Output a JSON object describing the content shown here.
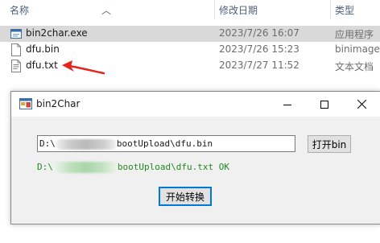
{
  "explorer": {
    "columns": {
      "name": "名称",
      "modified": "修改日期",
      "type": "类型"
    },
    "files": [
      {
        "name": "bin2char.exe",
        "modified": "2023/7/26 16:07",
        "type": "应用程序",
        "icon": "exe-icon",
        "selected": true
      },
      {
        "name": "dfu.bin",
        "modified": "2023/7/26 15:23",
        "type": "binimage",
        "icon": "file-icon",
        "selected": false
      },
      {
        "name": "dfu.txt",
        "modified": "2023/7/27 11:52",
        "type": "文本文档",
        "icon": "text-file-icon",
        "selected": false
      }
    ],
    "annotation_color": "#e8231b"
  },
  "dialog": {
    "title": "bin2Char",
    "input_prefix": "D:\\",
    "input_suffix": "bootUpload\\dfu.bin",
    "open_button": "打开bin",
    "status_prefix": "D:\\",
    "status_suffix": "bootUpload\\dfu.txt OK",
    "start_button": "开始转换",
    "status_color": "#1e8a1e",
    "focus_color": "#0078d7"
  }
}
